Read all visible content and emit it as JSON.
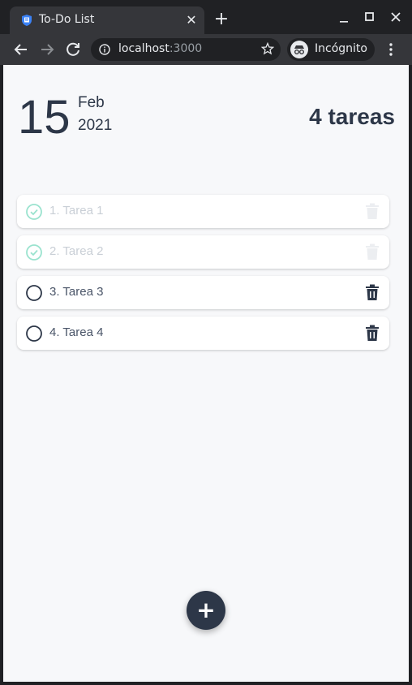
{
  "browser": {
    "tab_title": "To-Do List",
    "url_host": "localhost",
    "url_port": ":3000",
    "incognito_label": "Incógnito"
  },
  "header": {
    "day": "15",
    "month": "Feb",
    "year": "2021",
    "task_count": "4 tareas"
  },
  "tasks": [
    {
      "label": "1. Tarea 1",
      "done": true
    },
    {
      "label": "2. Tarea 2",
      "done": true
    },
    {
      "label": "3. Tarea 3",
      "done": false
    },
    {
      "label": "4. Tarea 4",
      "done": false
    }
  ],
  "fab": {
    "icon": "plus-icon",
    "label": "+"
  },
  "colors": {
    "text_dark": "#2d3748",
    "done_accent": "#9be3cf",
    "done_text": "#c9cfd6",
    "page_bg": "#f7f8fa"
  }
}
